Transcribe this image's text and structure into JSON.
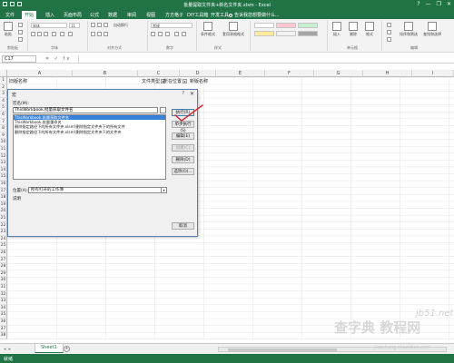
{
  "window": {
    "title": "批量提取文件夹+新名文件夹.xlsm - Excel",
    "controls": [
      "?",
      "—",
      "❐",
      "✕"
    ]
  },
  "ribbon_tabs": [
    "文件",
    "开始",
    "插入",
    "页面布局",
    "公式",
    "数据",
    "审阅",
    "视图",
    "方方格子",
    "DIY工具箱",
    "开发工具"
  ],
  "active_tab": "开始",
  "tell_me": "告诉我您想要做什么...",
  "ribbon": {
    "paste": "粘贴",
    "font_name": "宋体",
    "font_size": "11",
    "wrap": "自动换行",
    "number_format": "常规",
    "cond_format": "条件格式",
    "table_format": "套用表格格式",
    "cell_styles": "单元格样式",
    "insert": "插入",
    "delete": "删除",
    "format": "格式",
    "sort": "排序和筛选",
    "find": "查找和选择",
    "groups": {
      "clipboard": "剪贴板",
      "font": "字体",
      "align": "对齐方式",
      "number": "数字",
      "styles": "样式",
      "cells": "单元格",
      "editing": "编辑"
    }
  },
  "formula_bar": {
    "name_box": "C17",
    "fx": "✕ ✓ fx",
    "formula": ""
  },
  "columns": [
    "A",
    "B",
    "C",
    "D",
    "E",
    "F",
    "G",
    "H",
    "I"
  ],
  "rows": [
    "1",
    "2",
    "3",
    "4",
    "5",
    "6",
    "7",
    "8",
    "9",
    "10",
    "11",
    "12",
    "13",
    "14",
    "15",
    "16",
    "17",
    "18",
    "19",
    "20",
    "21",
    "22",
    "23",
    "24",
    "25",
    "26",
    "27",
    "28",
    "29",
    "30",
    "31",
    "32",
    "33",
    "34",
    "35",
    "36",
    "37",
    "38"
  ],
  "cells": {
    "a1": "旧版名称",
    "b1": "文件类型",
    "c1": "所在位置",
    "d1": "新版名称"
  },
  "dialog": {
    "title": "宏",
    "help": "?",
    "close": "✕",
    "name_label": "宏名(M):",
    "name_value": "ThisWorkbook.批量获取文件名",
    "macros": [
      "ThisWorkbook.批量获取文件名",
      "ThisWorkbook.批量重命名",
      "删除指定路径下的所有文件夹.xlsm!删除指定文件夹下的所有文件",
      "删除指定路径下的所有文件夹.xlsm!删除指定文件夹下的文件夹"
    ],
    "selected_index": 0,
    "buttons": [
      "执行(R)",
      "单步执行(S)",
      "编辑(E)",
      "创建(C)",
      "删除(D)",
      "选项(O)..."
    ],
    "position_label": "位置(A):",
    "position_value": "所有打开的工作簿",
    "description_label": "说明",
    "cancel": "取消"
  },
  "sheet_tabs": [
    "Sheet1"
  ],
  "status": "就绪",
  "watermark": {
    "big": "查字典 教程网",
    "site": "jb51.net",
    "url": "jiaocheng.chazidian.com"
  },
  "colors": {
    "excel_green": "#217346",
    "selection_blue": "#3a82d9",
    "annotation_red": "#d9232e"
  }
}
